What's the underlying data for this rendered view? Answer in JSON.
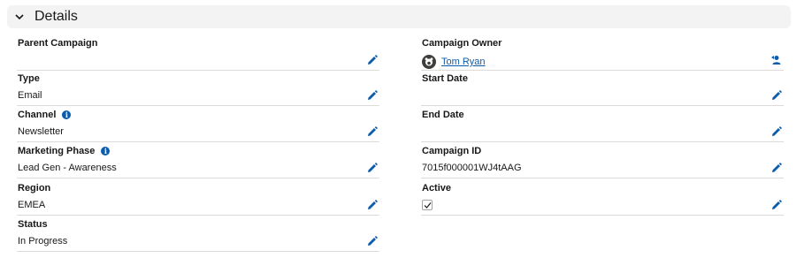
{
  "section": {
    "title": "Details",
    "icon": "chevron-down-icon"
  },
  "left_fields": [
    {
      "label": "Parent Campaign",
      "value": ""
    },
    {
      "label": "Type",
      "value": "Email"
    },
    {
      "label": "Channel",
      "value": "Newsletter",
      "info": true
    },
    {
      "label": "Marketing Phase",
      "value": "Lead Gen - Awareness",
      "info": true
    },
    {
      "label": "Region",
      "value": "EMEA"
    },
    {
      "label": "Status",
      "value": "In Progress"
    }
  ],
  "right_fields": [
    {
      "label": "Campaign Owner",
      "value": "Tom Ryan"
    },
    {
      "label": "Start Date",
      "value": ""
    },
    {
      "label": "End Date",
      "value": ""
    },
    {
      "label": "Campaign ID",
      "value": "7015f000001WJ4tAAG"
    },
    {
      "label": "Active",
      "value": "",
      "checked": true
    }
  ],
  "colors": {
    "accent": "#0b5cab",
    "border": "#dddbda",
    "header_bg": "#f3f3f3"
  }
}
